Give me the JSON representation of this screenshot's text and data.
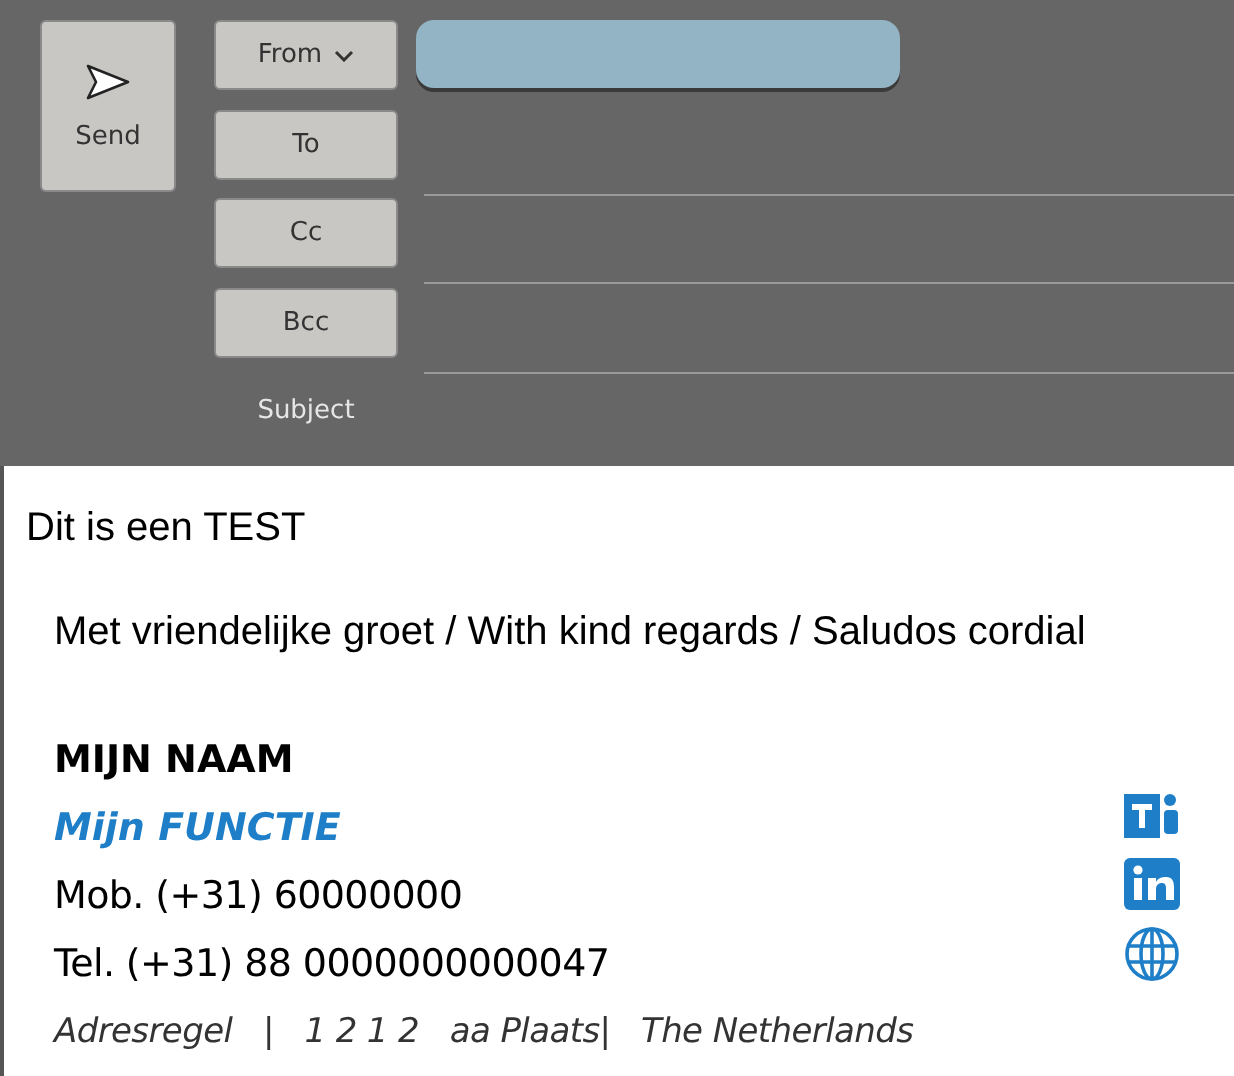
{
  "send_button": {
    "label": "Send"
  },
  "address_rows": [
    {
      "kind": "dropdown",
      "label": "From"
    },
    {
      "kind": "button",
      "label": "To"
    },
    {
      "kind": "button",
      "label": "Cc"
    },
    {
      "kind": "button",
      "label": "Bcc"
    },
    {
      "kind": "label",
      "label": "Subject"
    }
  ],
  "body": {
    "first_line": "Dit is een TEST",
    "greeting": "Met vriendelijke groet / With kind regards / Saludos cordial"
  },
  "signature": {
    "name": "MIJN NAAM",
    "job_title": "Mijn FUNCTIE",
    "mobile": "Mob. (+31) 60000000",
    "phone": "Tel. (+31) 88 0000000000047",
    "address": "Adresregel   |   1 2 1 2   aa Plaats|   The Netherlands",
    "links": [
      {
        "kind": "teams"
      },
      {
        "kind": "linkedin"
      },
      {
        "kind": "web"
      }
    ]
  }
}
